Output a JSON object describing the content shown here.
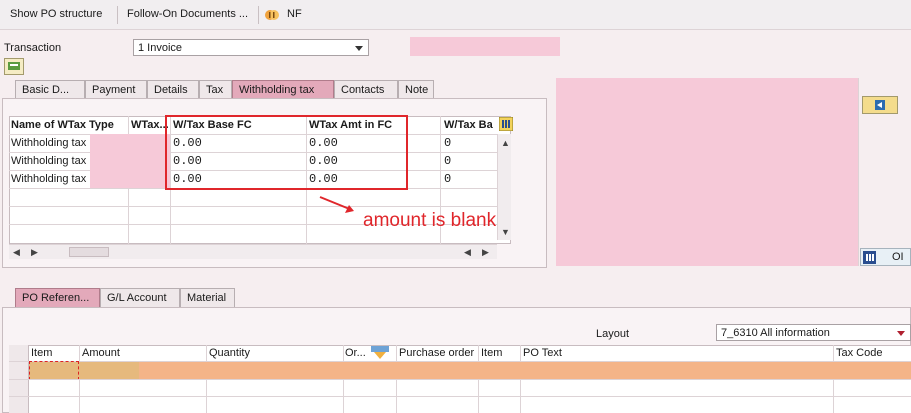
{
  "toolbar": {
    "show_po_structure": "Show PO structure",
    "follow_on_documents": "Follow-On Documents ...",
    "nf_label": "NF"
  },
  "header": {
    "transaction_label": "Transaction",
    "transaction_value": "1 Invoice"
  },
  "tabs_top": [
    {
      "label": "Basic D..."
    },
    {
      "label": "Payment"
    },
    {
      "label": "Details"
    },
    {
      "label": "Tax"
    },
    {
      "label": "Withholding tax"
    },
    {
      "label": "Contacts"
    },
    {
      "label": "Note"
    }
  ],
  "wtax_grid": {
    "columns": [
      "Name of WTax Type",
      "WTax...",
      "W/Tax Base FC",
      "WTax Amt in FC",
      "W/Tax Ba"
    ],
    "rows": [
      {
        "name": "Withholding tax",
        "base": "0.00",
        "amount": "0.00",
        "base2": "0"
      },
      {
        "name": "Withholding tax",
        "base": "0.00",
        "amount": "0.00",
        "base2": "0"
      },
      {
        "name": "Withholding tax",
        "base": "0.00",
        "amount": "0.00",
        "base2": "0"
      }
    ]
  },
  "annotation": "amount is blank",
  "right_panel": {
    "oi_label": "OI"
  },
  "tabs_bottom": [
    {
      "label": "PO Referen..."
    },
    {
      "label": "G/L Account"
    },
    {
      "label": "Material"
    }
  ],
  "layout": {
    "label": "Layout",
    "value": "7_6310 All information"
  },
  "po_grid": {
    "columns": [
      "Item",
      "Amount",
      "Quantity",
      "Or...",
      "Purchase order",
      "Item",
      "PO Text",
      "Tax Code"
    ]
  },
  "colors": {
    "pink_accent": "#f6c9d8",
    "tab_active": "#e3a9ba",
    "annotation_red": "#e0262b",
    "row_highlight": "#f4b488"
  }
}
